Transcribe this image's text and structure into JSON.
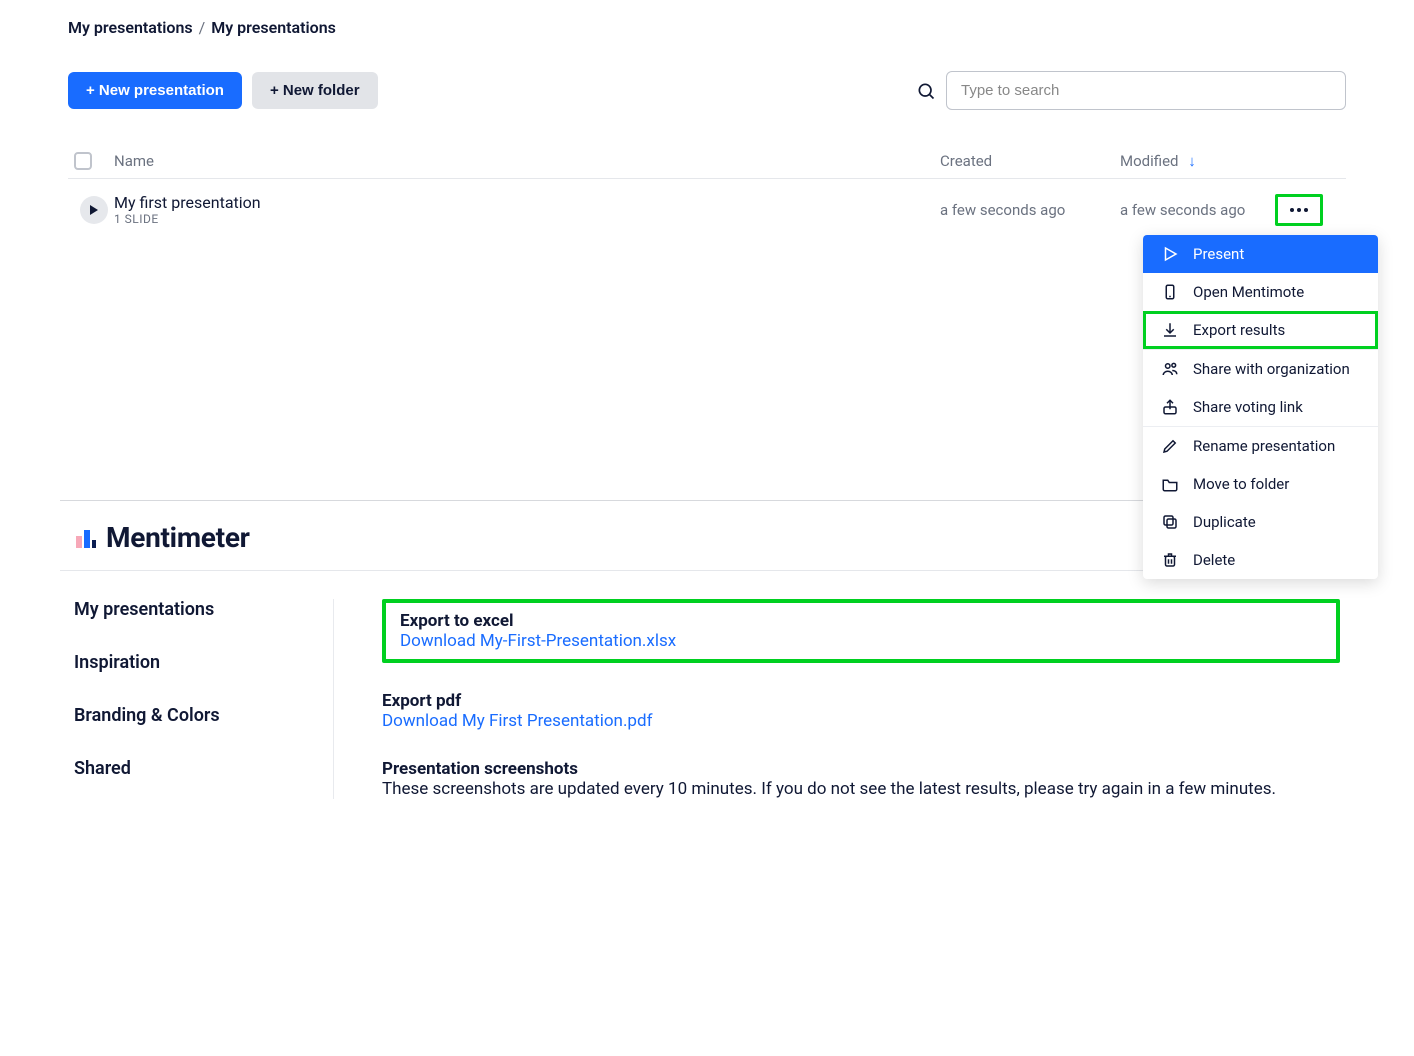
{
  "breadcrumb": {
    "root": "My presentations",
    "current": "My presentations"
  },
  "toolbar": {
    "new_presentation": "+ New presentation",
    "new_folder": "+ New folder",
    "search_placeholder": "Type to search"
  },
  "columns": {
    "name": "Name",
    "created": "Created",
    "modified": "Modified"
  },
  "row": {
    "title": "My first presentation",
    "subtitle": "1 SLIDE",
    "created": "a few seconds ago",
    "modified": "a few seconds ago"
  },
  "menu": {
    "present": "Present",
    "mentimote": "Open Mentimote",
    "export_results": "Export results",
    "share_org": "Share with organization",
    "share_voting": "Share voting link",
    "rename": "Rename presentation",
    "move": "Move to folder",
    "duplicate": "Duplicate",
    "delete": "Delete"
  },
  "brand": {
    "name": "Mentimeter"
  },
  "sidebar": {
    "my_presentations": "My presentations",
    "inspiration": "Inspiration",
    "branding": "Branding & Colors",
    "shared": "Shared"
  },
  "export": {
    "excel_title": "Export to excel",
    "excel_link": "Download My-First-Presentation.xlsx",
    "pdf_title": "Export pdf",
    "pdf_link": "Download My First Presentation.pdf",
    "screenshots_title": "Presentation screenshots",
    "screenshots_text": "These screenshots are updated every 10 minutes. If you do not see the latest results, please try again in a few minutes."
  }
}
